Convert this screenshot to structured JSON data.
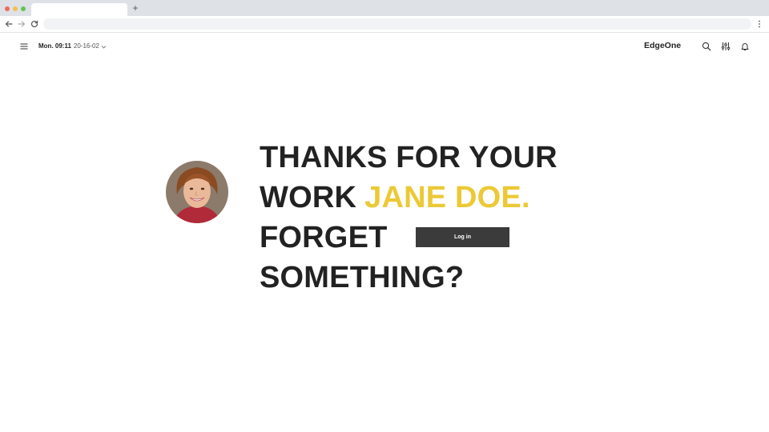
{
  "browser": {
    "new_tab_glyph": "+",
    "icons": [
      "back-arrow-icon",
      "forward-arrow-icon",
      "reload-icon",
      "kebab-menu-icon"
    ]
  },
  "header": {
    "day_time": "Mon. 09:11",
    "date": "20-16-02",
    "brand": "EdgeOne",
    "icons": [
      "menu-icon",
      "chevron-down-icon",
      "search-icon",
      "sliders-icon",
      "bell-icon"
    ]
  },
  "main": {
    "headline": {
      "line1": "THANKS FOR YOUR",
      "line2_prefix": "WORK",
      "user_name": "JANE DOE.",
      "line3": "FORGET",
      "line4": "SOMETHING?"
    },
    "login_label": "Log in"
  },
  "colors": {
    "accent_name": "#ecc935",
    "button_bg": "#3b3b3b",
    "headline_text": "#222222"
  }
}
